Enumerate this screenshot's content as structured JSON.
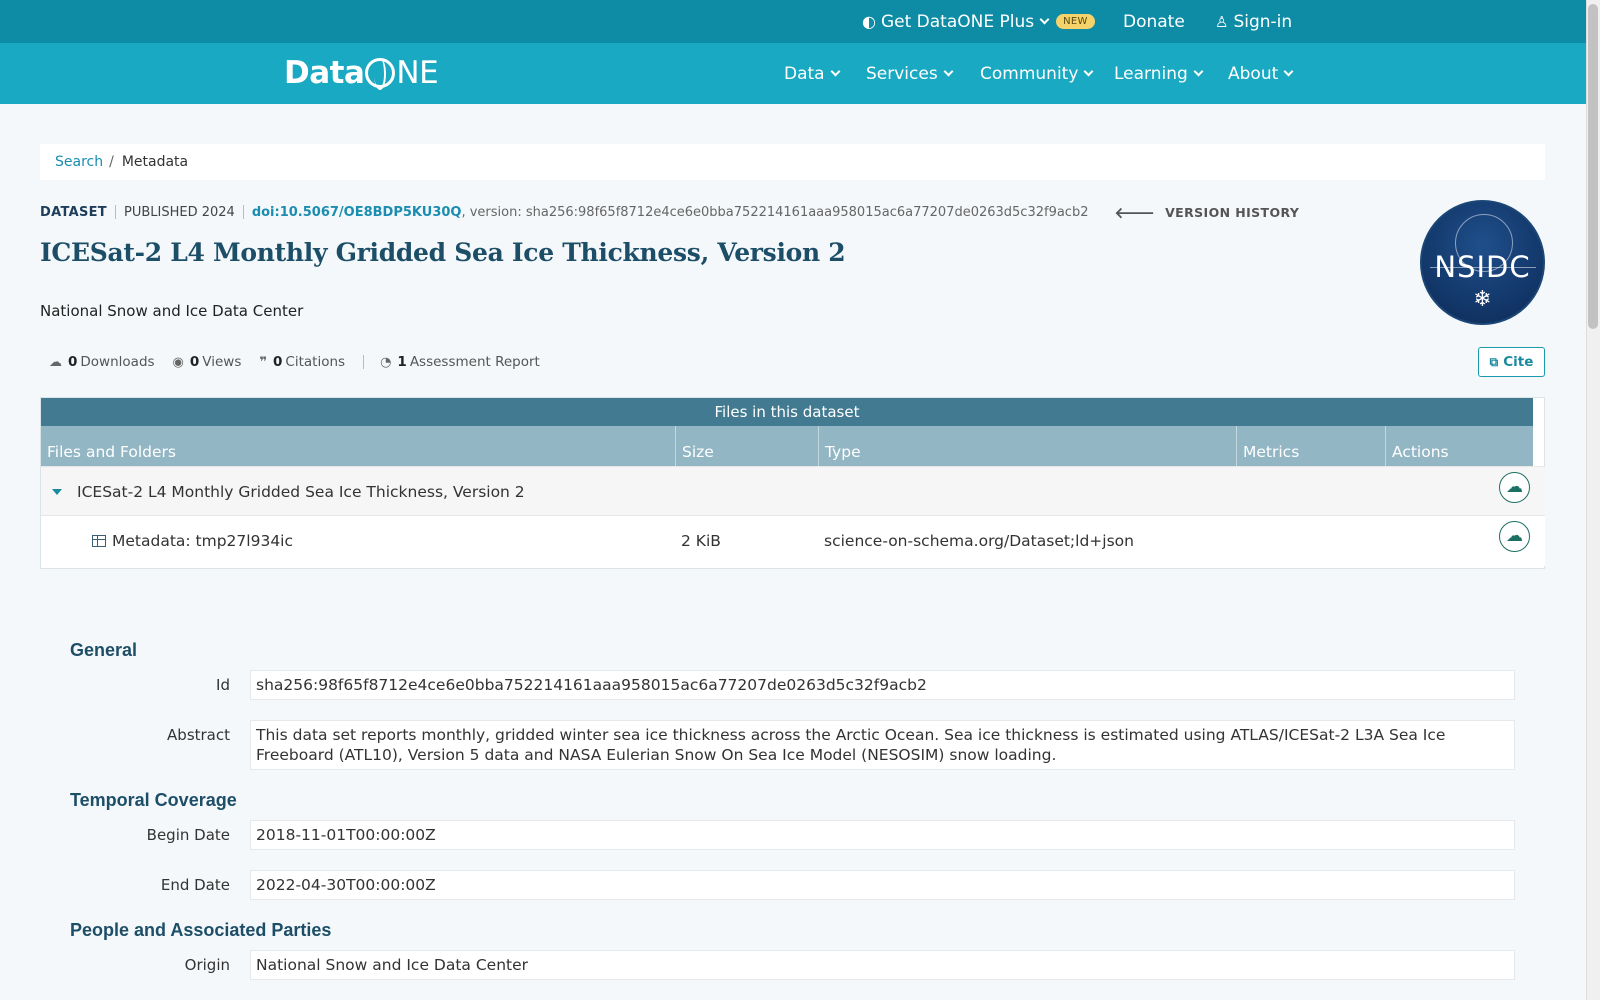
{
  "topbar": {
    "plus_label": "Get DataONE Plus",
    "new_badge": "NEW",
    "donate": "Donate",
    "signin": "Sign-in"
  },
  "nav": {
    "logo_data": "Data",
    "logo_rest": "NE",
    "items": [
      "Data",
      "Services",
      "Community",
      "Learning",
      "About"
    ]
  },
  "breadcrumb": {
    "search": "Search",
    "separator": "/",
    "current": "Metadata"
  },
  "dataset": {
    "type": "DATASET",
    "published": "PUBLISHED 2024",
    "doi": "doi:10.5067/OE8BDP5KU30Q",
    "version": ", version: sha256:98f65f8712e4ce6e0bba752214161aaa958015ac6a77207de0263d5c32f9acb2",
    "version_history": "VERSION HISTORY",
    "title": "ICESat-2 L4 Monthly Gridded Sea Ice Thickness, Version 2",
    "organization": "National Snow and Ice Data Center",
    "logo_text": "NSIDC"
  },
  "stats": {
    "downloads_count": "0",
    "downloads_label": "Downloads",
    "views_count": "0",
    "views_label": "Views",
    "citations_count": "0",
    "citations_label": "Citations",
    "assessment_count": "1",
    "assessment_label": "Assessment Report",
    "cite_label": "Cite"
  },
  "files": {
    "caption": "Files in this dataset",
    "columns": [
      "Files and Folders",
      "Size",
      "Type",
      "Metrics",
      "Actions"
    ],
    "package_row": {
      "name": "ICESat-2 L4 Monthly Gridded Sea Ice Thickness, Version 2"
    },
    "rows": [
      {
        "name": "Metadata: tmp27l934ic",
        "size": "2 KiB",
        "type": "science-on-schema.org/Dataset;ld+json"
      }
    ]
  },
  "metadata": {
    "general_heading": "General",
    "id_label": "Id",
    "id_value": "sha256:98f65f8712e4ce6e0bba752214161aaa958015ac6a77207de0263d5c32f9acb2",
    "abstract_label": "Abstract",
    "abstract_value": "This data set reports monthly, gridded winter sea ice thickness across the Arctic Ocean. Sea ice thickness is estimated using ATLAS/ICESat-2 L3A Sea Ice Freeboard (ATL10), Version 5 data and NASA Eulerian Snow On Sea Ice Model (NESOSIM) snow loading.",
    "temporal_heading": "Temporal Coverage",
    "begin_label": "Begin Date",
    "begin_value": "2018-11-01T00:00:00Z",
    "end_label": "End Date",
    "end_value": "2022-04-30T00:00:00Z",
    "people_heading": "People and Associated Parties",
    "origin_label": "Origin",
    "origin_value": "National Snow and Ice Data Center"
  },
  "colors": {
    "topbar": "#0f8ca5",
    "nav": "#1aa9c2",
    "title": "#1d4e68",
    "link": "#1a8db0",
    "table_caption": "#427b91",
    "table_header": "#93b6c4"
  }
}
